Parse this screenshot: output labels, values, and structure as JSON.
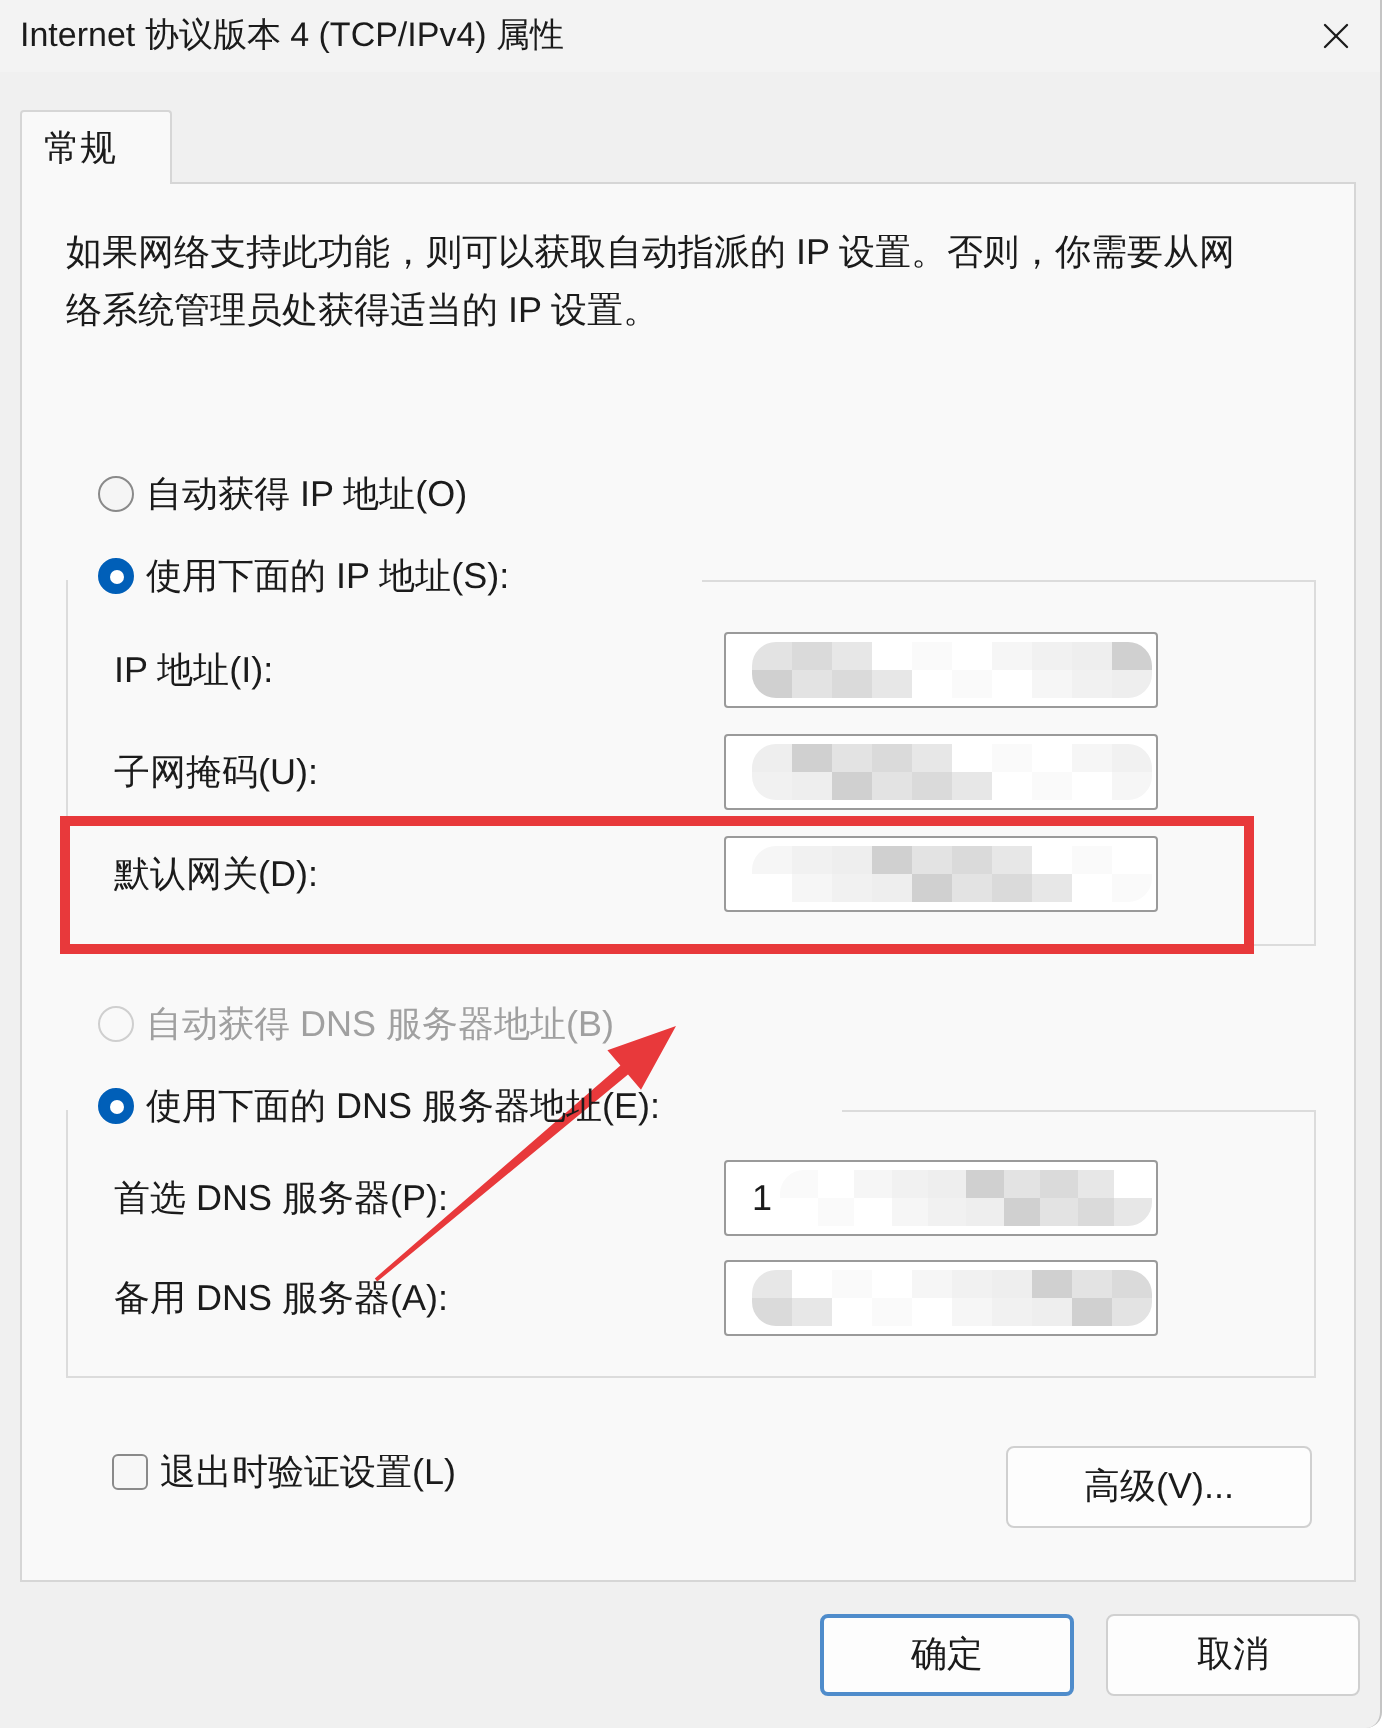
{
  "window": {
    "title": "Internet 协议版本 4 (TCP/IPv4) 属性"
  },
  "tabs": [
    {
      "label": "常规",
      "selected": true
    }
  ],
  "description": "如果网络支持此功能，则可以获取自动指派的 IP 设置。否则，你需要从网络系统管理员处获得适当的 IP 设置。",
  "ip_section": {
    "auto_option": {
      "label": "自动获得 IP 地址(O)",
      "selected": false,
      "disabled": false
    },
    "manual_option": {
      "label": "使用下面的 IP 地址(S):",
      "selected": true,
      "disabled": false
    },
    "fields": [
      {
        "label": "IP 地址(I):",
        "obscured": true,
        "highlighted": false
      },
      {
        "label": "子网掩码(U):",
        "obscured": true,
        "highlighted": false
      },
      {
        "label": "默认网关(D):",
        "obscured": true,
        "highlighted": true
      }
    ]
  },
  "dns_section": {
    "auto_option": {
      "label": "自动获得 DNS 服务器地址(B)",
      "selected": false,
      "disabled": true
    },
    "manual_option": {
      "label": "使用下面的 DNS 服务器地址(E):",
      "selected": true,
      "disabled": false
    },
    "fields": [
      {
        "label": "首选 DNS 服务器(P):",
        "value": "1",
        "obscured": true,
        "highlighted": false
      },
      {
        "label": "备用 DNS 服务器(A):",
        "obscured": true,
        "highlighted": false
      }
    ]
  },
  "validate_on_exit": {
    "label": "退出时验证设置(L)",
    "checked": false
  },
  "advanced_button": "高级(V)...",
  "buttons": [
    {
      "label": "确定",
      "default": true
    },
    {
      "label": "取消",
      "default": false
    }
  ]
}
